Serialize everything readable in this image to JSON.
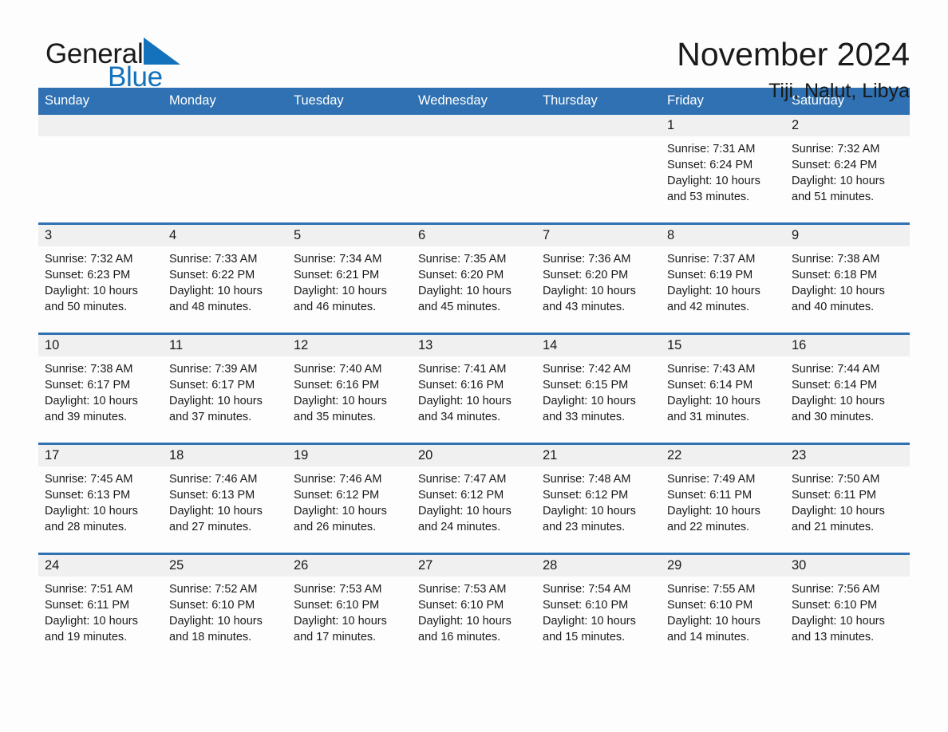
{
  "brand": {
    "name_part1": "General",
    "name_part2": "Blue",
    "triangle_color": "#1372bb",
    "text_color": "#1a1a1a"
  },
  "header": {
    "month_title": "November 2024",
    "location": "Tiji, Nalut, Libya"
  },
  "colors": {
    "header_blue": "#2f71b2",
    "row_divider_blue": "#2f71b2",
    "daynum_band": "#f0f0f0",
    "page_background": "#fdfdfd",
    "text": "#1a1a1a",
    "header_text": "#ffffff"
  },
  "weekday_headers": [
    "Sunday",
    "Monday",
    "Tuesday",
    "Wednesday",
    "Thursday",
    "Friday",
    "Saturday"
  ],
  "weeks": [
    [
      {
        "day": "",
        "sunrise": "",
        "sunset": "",
        "daylight_line1": "",
        "daylight_line2": ""
      },
      {
        "day": "",
        "sunrise": "",
        "sunset": "",
        "daylight_line1": "",
        "daylight_line2": ""
      },
      {
        "day": "",
        "sunrise": "",
        "sunset": "",
        "daylight_line1": "",
        "daylight_line2": ""
      },
      {
        "day": "",
        "sunrise": "",
        "sunset": "",
        "daylight_line1": "",
        "daylight_line2": ""
      },
      {
        "day": "",
        "sunrise": "",
        "sunset": "",
        "daylight_line1": "",
        "daylight_line2": ""
      },
      {
        "day": "1",
        "sunrise": "Sunrise: 7:31 AM",
        "sunset": "Sunset: 6:24 PM",
        "daylight_line1": "Daylight: 10 hours",
        "daylight_line2": "and 53 minutes."
      },
      {
        "day": "2",
        "sunrise": "Sunrise: 7:32 AM",
        "sunset": "Sunset: 6:24 PM",
        "daylight_line1": "Daylight: 10 hours",
        "daylight_line2": "and 51 minutes."
      }
    ],
    [
      {
        "day": "3",
        "sunrise": "Sunrise: 7:32 AM",
        "sunset": "Sunset: 6:23 PM",
        "daylight_line1": "Daylight: 10 hours",
        "daylight_line2": "and 50 minutes."
      },
      {
        "day": "4",
        "sunrise": "Sunrise: 7:33 AM",
        "sunset": "Sunset: 6:22 PM",
        "daylight_line1": "Daylight: 10 hours",
        "daylight_line2": "and 48 minutes."
      },
      {
        "day": "5",
        "sunrise": "Sunrise: 7:34 AM",
        "sunset": "Sunset: 6:21 PM",
        "daylight_line1": "Daylight: 10 hours",
        "daylight_line2": "and 46 minutes."
      },
      {
        "day": "6",
        "sunrise": "Sunrise: 7:35 AM",
        "sunset": "Sunset: 6:20 PM",
        "daylight_line1": "Daylight: 10 hours",
        "daylight_line2": "and 45 minutes."
      },
      {
        "day": "7",
        "sunrise": "Sunrise: 7:36 AM",
        "sunset": "Sunset: 6:20 PM",
        "daylight_line1": "Daylight: 10 hours",
        "daylight_line2": "and 43 minutes."
      },
      {
        "day": "8",
        "sunrise": "Sunrise: 7:37 AM",
        "sunset": "Sunset: 6:19 PM",
        "daylight_line1": "Daylight: 10 hours",
        "daylight_line2": "and 42 minutes."
      },
      {
        "day": "9",
        "sunrise": "Sunrise: 7:38 AM",
        "sunset": "Sunset: 6:18 PM",
        "daylight_line1": "Daylight: 10 hours",
        "daylight_line2": "and 40 minutes."
      }
    ],
    [
      {
        "day": "10",
        "sunrise": "Sunrise: 7:38 AM",
        "sunset": "Sunset: 6:17 PM",
        "daylight_line1": "Daylight: 10 hours",
        "daylight_line2": "and 39 minutes."
      },
      {
        "day": "11",
        "sunrise": "Sunrise: 7:39 AM",
        "sunset": "Sunset: 6:17 PM",
        "daylight_line1": "Daylight: 10 hours",
        "daylight_line2": "and 37 minutes."
      },
      {
        "day": "12",
        "sunrise": "Sunrise: 7:40 AM",
        "sunset": "Sunset: 6:16 PM",
        "daylight_line1": "Daylight: 10 hours",
        "daylight_line2": "and 35 minutes."
      },
      {
        "day": "13",
        "sunrise": "Sunrise: 7:41 AM",
        "sunset": "Sunset: 6:16 PM",
        "daylight_line1": "Daylight: 10 hours",
        "daylight_line2": "and 34 minutes."
      },
      {
        "day": "14",
        "sunrise": "Sunrise: 7:42 AM",
        "sunset": "Sunset: 6:15 PM",
        "daylight_line1": "Daylight: 10 hours",
        "daylight_line2": "and 33 minutes."
      },
      {
        "day": "15",
        "sunrise": "Sunrise: 7:43 AM",
        "sunset": "Sunset: 6:14 PM",
        "daylight_line1": "Daylight: 10 hours",
        "daylight_line2": "and 31 minutes."
      },
      {
        "day": "16",
        "sunrise": "Sunrise: 7:44 AM",
        "sunset": "Sunset: 6:14 PM",
        "daylight_line1": "Daylight: 10 hours",
        "daylight_line2": "and 30 minutes."
      }
    ],
    [
      {
        "day": "17",
        "sunrise": "Sunrise: 7:45 AM",
        "sunset": "Sunset: 6:13 PM",
        "daylight_line1": "Daylight: 10 hours",
        "daylight_line2": "and 28 minutes."
      },
      {
        "day": "18",
        "sunrise": "Sunrise: 7:46 AM",
        "sunset": "Sunset: 6:13 PM",
        "daylight_line1": "Daylight: 10 hours",
        "daylight_line2": "and 27 minutes."
      },
      {
        "day": "19",
        "sunrise": "Sunrise: 7:46 AM",
        "sunset": "Sunset: 6:12 PM",
        "daylight_line1": "Daylight: 10 hours",
        "daylight_line2": "and 26 minutes."
      },
      {
        "day": "20",
        "sunrise": "Sunrise: 7:47 AM",
        "sunset": "Sunset: 6:12 PM",
        "daylight_line1": "Daylight: 10 hours",
        "daylight_line2": "and 24 minutes."
      },
      {
        "day": "21",
        "sunrise": "Sunrise: 7:48 AM",
        "sunset": "Sunset: 6:12 PM",
        "daylight_line1": "Daylight: 10 hours",
        "daylight_line2": "and 23 minutes."
      },
      {
        "day": "22",
        "sunrise": "Sunrise: 7:49 AM",
        "sunset": "Sunset: 6:11 PM",
        "daylight_line1": "Daylight: 10 hours",
        "daylight_line2": "and 22 minutes."
      },
      {
        "day": "23",
        "sunrise": "Sunrise: 7:50 AM",
        "sunset": "Sunset: 6:11 PM",
        "daylight_line1": "Daylight: 10 hours",
        "daylight_line2": "and 21 minutes."
      }
    ],
    [
      {
        "day": "24",
        "sunrise": "Sunrise: 7:51 AM",
        "sunset": "Sunset: 6:11 PM",
        "daylight_line1": "Daylight: 10 hours",
        "daylight_line2": "and 19 minutes."
      },
      {
        "day": "25",
        "sunrise": "Sunrise: 7:52 AM",
        "sunset": "Sunset: 6:10 PM",
        "daylight_line1": "Daylight: 10 hours",
        "daylight_line2": "and 18 minutes."
      },
      {
        "day": "26",
        "sunrise": "Sunrise: 7:53 AM",
        "sunset": "Sunset: 6:10 PM",
        "daylight_line1": "Daylight: 10 hours",
        "daylight_line2": "and 17 minutes."
      },
      {
        "day": "27",
        "sunrise": "Sunrise: 7:53 AM",
        "sunset": "Sunset: 6:10 PM",
        "daylight_line1": "Daylight: 10 hours",
        "daylight_line2": "and 16 minutes."
      },
      {
        "day": "28",
        "sunrise": "Sunrise: 7:54 AM",
        "sunset": "Sunset: 6:10 PM",
        "daylight_line1": "Daylight: 10 hours",
        "daylight_line2": "and 15 minutes."
      },
      {
        "day": "29",
        "sunrise": "Sunrise: 7:55 AM",
        "sunset": "Sunset: 6:10 PM",
        "daylight_line1": "Daylight: 10 hours",
        "daylight_line2": "and 14 minutes."
      },
      {
        "day": "30",
        "sunrise": "Sunrise: 7:56 AM",
        "sunset": "Sunset: 6:10 PM",
        "daylight_line1": "Daylight: 10 hours",
        "daylight_line2": "and 13 minutes."
      }
    ]
  ]
}
